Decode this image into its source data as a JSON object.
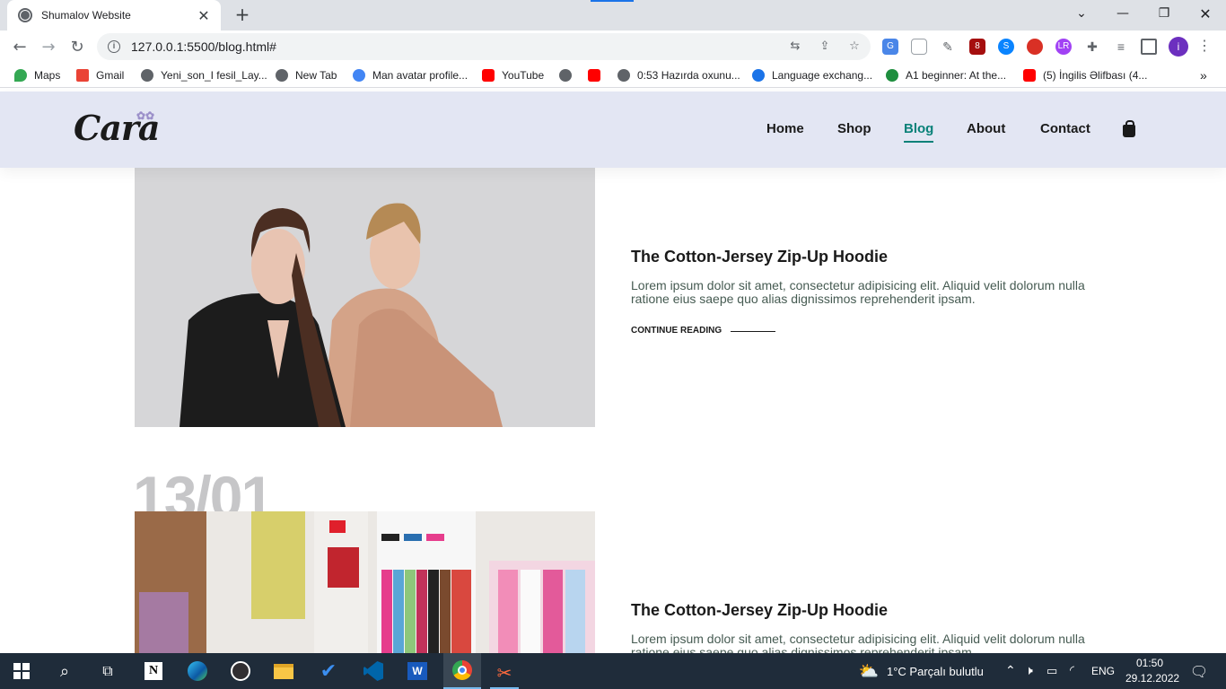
{
  "browser": {
    "tab_title": "Shumalov Website",
    "url": "127.0.0.1:5500/blog.html#",
    "bookmarks": [
      "Maps",
      "Gmail",
      "Yeni_son_I fesil_Lay...",
      "New Tab",
      "Man avatar profile...",
      "YouTube",
      "0:53 Hazırda oxunu...",
      "Language exchang...",
      "A1 beginner: At the...",
      "(5) İngilis Əlifbası (4..."
    ],
    "extension_badge": "8",
    "profile_initial": "i"
  },
  "site": {
    "logo": "Cara",
    "nav": [
      "Home",
      "Shop",
      "Blog",
      "About",
      "Contact"
    ],
    "active_nav": "Blog",
    "accent_color": "#088178",
    "header_bg": "#e3e6f3"
  },
  "posts": [
    {
      "title": "The Cotton-Jersey Zip-Up Hoodie",
      "text": "Lorem ipsum dolor sit amet, consectetur adipisicing elit. Aliquid velit dolorum nulla ratione eius saepe quo alias dignissimos reprehenderit ipsam.",
      "link": "CONTINUE READING"
    },
    {
      "date": "13/01",
      "title": "The Cotton-Jersey Zip-Up Hoodie",
      "text": "Lorem ipsum dolor sit amet, consectetur adipisicing elit. Aliquid velit dolorum nulla ratione eius saepe quo alias dignissimos reprehenderit ipsam."
    }
  ],
  "taskbar": {
    "weather": "1°C  Parçalı bulutlu",
    "language": "ENG",
    "time": "01:50",
    "date": "29.12.2022"
  }
}
